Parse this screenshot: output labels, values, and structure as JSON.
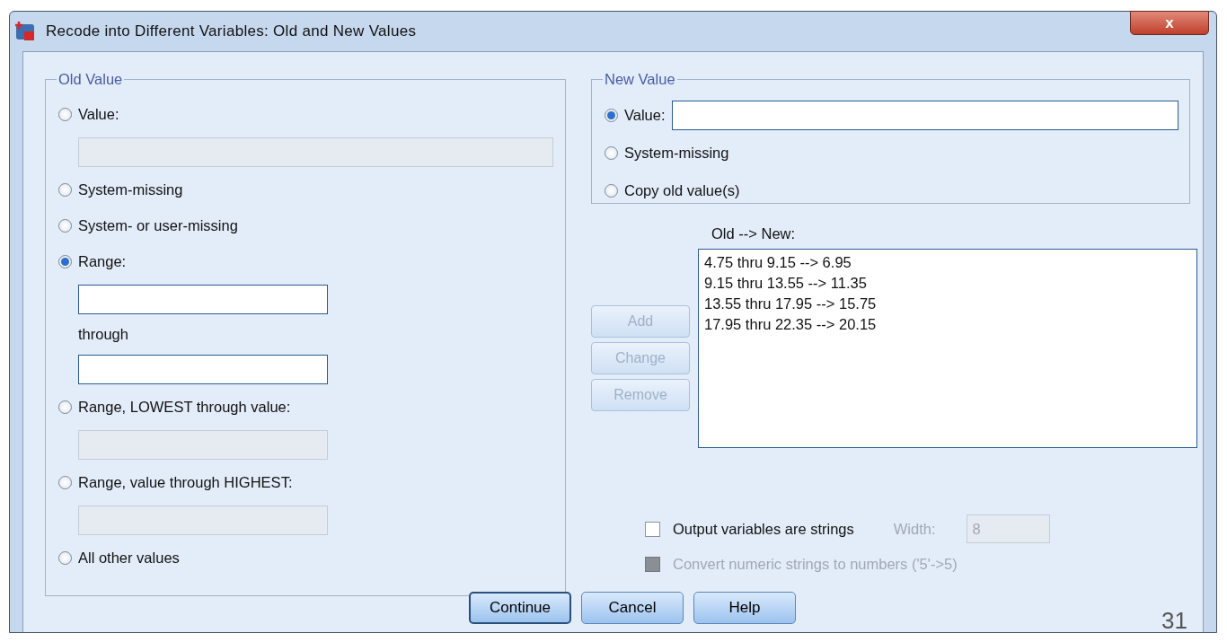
{
  "window": {
    "title": "Recode into Different Variables: Old and New Values",
    "close": "x"
  },
  "old_value": {
    "title": "Old Value",
    "items": [
      {
        "kind": "radio",
        "label": "Value:",
        "selected": false
      },
      {
        "kind": "wide_field",
        "disabled": true
      },
      {
        "kind": "radio",
        "label": "System-missing",
        "selected": false
      },
      {
        "kind": "radio",
        "label": "System- or user-missing",
        "selected": false
      },
      {
        "kind": "radio",
        "label": "Range:",
        "selected": true
      },
      {
        "kind": "field",
        "disabled": false
      },
      {
        "kind": "label",
        "label": "through"
      },
      {
        "kind": "field",
        "disabled": false
      },
      {
        "kind": "radio",
        "label": "Range, LOWEST through value:",
        "selected": false
      },
      {
        "kind": "field",
        "disabled": true
      },
      {
        "kind": "radio",
        "label": "Range, value through HIGHEST:",
        "selected": false
      },
      {
        "kind": "field",
        "disabled": true
      },
      {
        "kind": "radio",
        "label": "All other values",
        "selected": false
      }
    ]
  },
  "new_value": {
    "title": "New Value",
    "items": [
      {
        "kind": "radio_field",
        "label": "Value:",
        "selected": true
      },
      {
        "kind": "radio",
        "label": "System-missing",
        "selected": false
      },
      {
        "kind": "radio",
        "label": "Copy old value(s)",
        "selected": false
      }
    ]
  },
  "mapping": {
    "label": "Old --> New:",
    "rows": [
      "4.75 thru 9.15 --> 6.95",
      "9.15 thru 13.55 --> 11.35",
      "13.55 thru 17.95 --> 15.75",
      "17.95 thru 22.35 --> 20.15"
    ]
  },
  "side_buttons": [
    {
      "label": "Add",
      "disabled": true
    },
    {
      "label": "Change",
      "disabled": true
    },
    {
      "label": "Remove",
      "disabled": true
    }
  ],
  "output_strings": {
    "label": "Output variables are strings",
    "checked": false,
    "disabled": false
  },
  "width": {
    "label": "Width:",
    "value": "8",
    "disabled": true
  },
  "convert": {
    "label": "Convert numeric strings to numbers ('5'->5)",
    "checked": false,
    "disabled": true
  },
  "buttons": [
    {
      "label": "Continue",
      "default": true
    },
    {
      "label": "Cancel",
      "default": false
    },
    {
      "label": "Help",
      "default": false
    }
  ],
  "slide_number": "31"
}
